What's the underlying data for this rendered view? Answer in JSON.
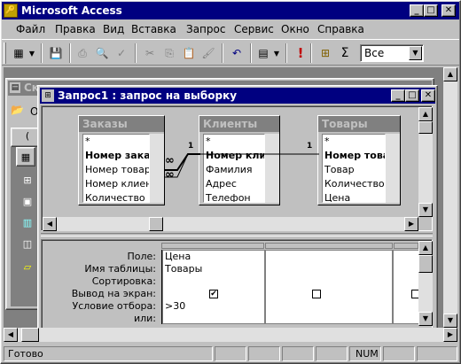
{
  "app": {
    "title": "Microsoft Access"
  },
  "menu": [
    "Файл",
    "Правка",
    "Вид",
    "Вставка",
    "Запрос",
    "Сервис",
    "Окно",
    "Справка"
  ],
  "toolbar": {
    "combo_value": "Все"
  },
  "db_window": {
    "title": "Ск",
    "label": "О",
    "tab": "("
  },
  "query": {
    "title": "Запрос1 : запрос на выборку",
    "tables": [
      {
        "name": "Заказы",
        "fields": [
          "*",
          "Номер заказа",
          "Номер товара",
          "Номер клиента",
          "Количество"
        ],
        "bold": 1
      },
      {
        "name": "Клиенты",
        "fields": [
          "*",
          "Номер клиента",
          "Фамилия",
          "Адрес",
          "Телефон"
        ],
        "bold": 1
      },
      {
        "name": "Товары",
        "fields": [
          "*",
          "Номер товара",
          "Товар",
          "Количество",
          "Цена"
        ],
        "bold": 1
      }
    ],
    "joins": [
      {
        "left": "∞",
        "right": "1"
      },
      {
        "left": "∞",
        "right": "1"
      }
    ],
    "grid": {
      "rows": [
        "Поле:",
        "Имя таблицы:",
        "Сортировка:",
        "Вывод на экран:",
        "Условие отбора:",
        "или:"
      ],
      "col1": {
        "field": "Цена",
        "table": "Товары",
        "sort": "",
        "show": true,
        "criteria": ">30",
        "or": ""
      },
      "col2": {
        "show": false
      },
      "col3": {
        "show": false
      }
    }
  },
  "status": {
    "text": "Готово",
    "num": "NUM"
  }
}
